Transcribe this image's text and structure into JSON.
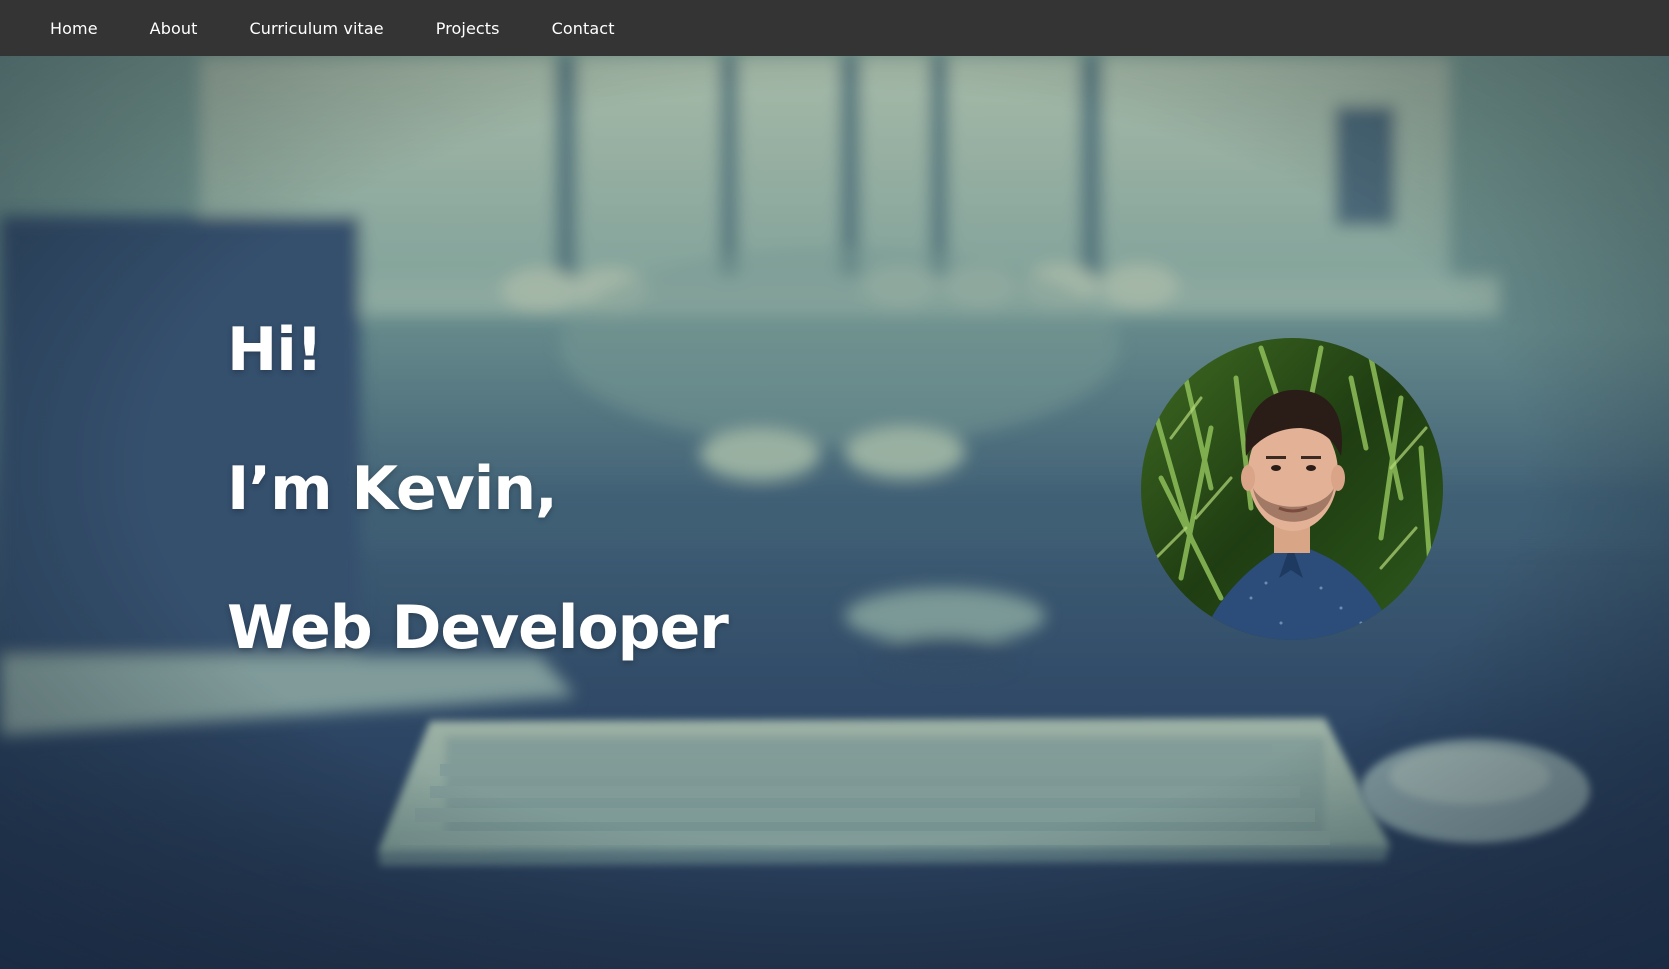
{
  "nav": {
    "items": [
      {
        "label": "Home"
      },
      {
        "label": "About"
      },
      {
        "label": "Curriculum vitae"
      },
      {
        "label": "Projects"
      },
      {
        "label": "Contact"
      }
    ],
    "background_color": "#343434",
    "text_color": "#ffffff"
  },
  "hero": {
    "line1": "Hi!",
    "line2": "I’m Kevin,",
    "line3": "Web Developer",
    "background_image": "blurred desk with laptop, wireless keyboard and mouse",
    "avatar_image": "portrait photo of a young man in a blue shirt in front of green foliage",
    "text_color": "#ffffff"
  }
}
